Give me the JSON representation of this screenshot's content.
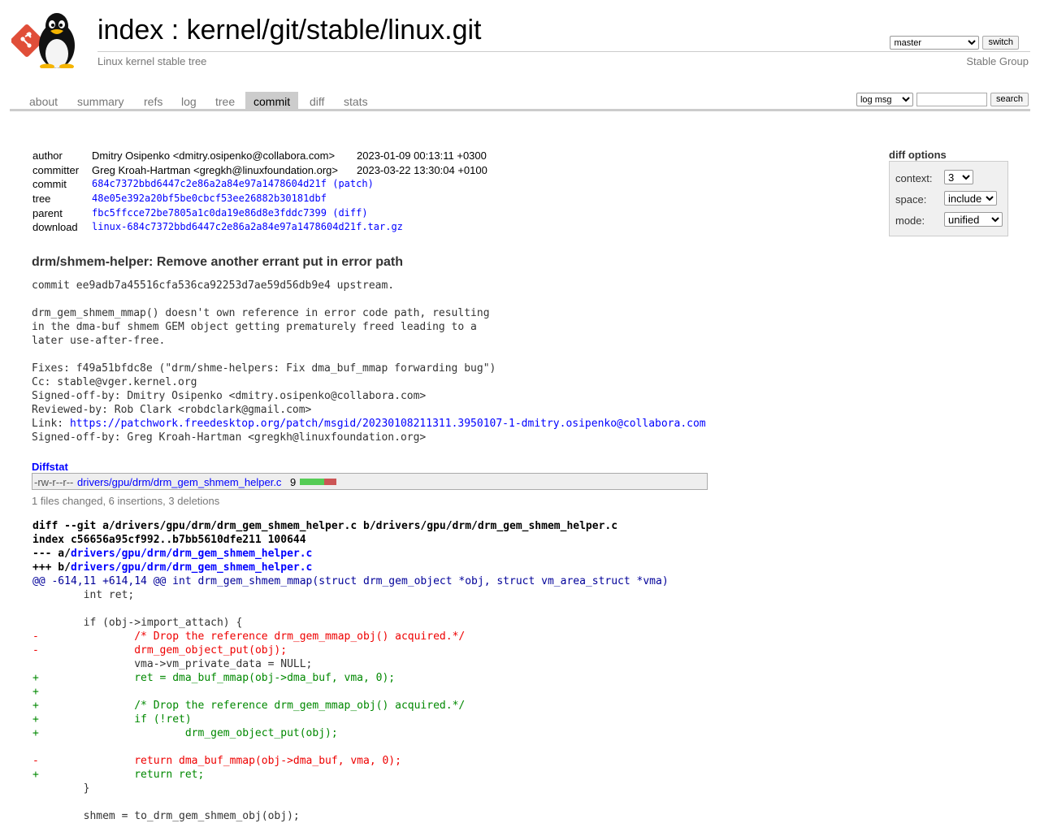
{
  "header": {
    "repo_prefix": "index",
    "separator": " : ",
    "repo_path": "kernel/git/stable/linux.git",
    "description": "Linux kernel stable tree",
    "owner": "Stable Group",
    "branch_selected": "master",
    "switch_label": "switch"
  },
  "tabs": [
    {
      "label": "about",
      "active": false
    },
    {
      "label": "summary",
      "active": false
    },
    {
      "label": "refs",
      "active": false
    },
    {
      "label": "log",
      "active": false
    },
    {
      "label": "tree",
      "active": false
    },
    {
      "label": "commit",
      "active": true
    },
    {
      "label": "diff",
      "active": false
    },
    {
      "label": "stats",
      "active": false
    }
  ],
  "search": {
    "type_selected": "log msg",
    "query": "",
    "button_label": "search"
  },
  "commit_info": {
    "author_label": "author",
    "author": "Dmitry Osipenko <dmitry.osipenko@collabora.com>",
    "author_date": "2023-01-09 00:13:11 +0300",
    "committer_label": "committer",
    "committer": "Greg Kroah-Hartman <gregkh@linuxfoundation.org>",
    "committer_date": "2023-03-22 13:30:04 +0100",
    "commit_label": "commit",
    "commit_hash": "684c7372bbd6447c2e86a2a84e97a1478604d21f",
    "commit_extra": "(patch)",
    "tree_label": "tree",
    "tree_hash": "48e05e392a20bf5be0cbcf53ee26882b30181dbf",
    "parent_label": "parent",
    "parent_hash": "fbc5ffcce72be7805a1c0da19e86d8e3fddc7399",
    "parent_extra": "(diff)",
    "download_label": "download",
    "download_file": "linux-684c7372bbd6447c2e86a2a84e97a1478604d21f.tar.gz"
  },
  "diff_options": {
    "title": "diff options",
    "context_label": "context:",
    "context_value": "3",
    "space_label": "space:",
    "space_value": "include",
    "mode_label": "mode:",
    "mode_value": "unified"
  },
  "commit_subject": "drm/shmem-helper: Remove another errant put in error path",
  "commit_message": {
    "before_link": "commit ee9adb7a45516cfa536ca92253d7ae59d56db9e4 upstream.\n\ndrm_gem_shmem_mmap() doesn't own reference in error code path, resulting\nin the dma-buf shmem GEM object getting prematurely freed leading to a\nlater use-after-free.\n\nFixes: f49a51bfdc8e (\"drm/shme-helpers: Fix dma_buf_mmap forwarding bug\")\nCc: stable@vger.kernel.org\nSigned-off-by: Dmitry Osipenko <dmitry.osipenko@collabora.com>\nReviewed-by: Rob Clark <robdclark@gmail.com>\nLink: ",
    "link": "https://patchwork.freedesktop.org/patch/msgid/20230108211311.3950107-1-dmitry.osipenko@collabora.com",
    "after_link": "\nSigned-off-by: Greg Kroah-Hartman <gregkh@linuxfoundation.org>"
  },
  "diffstat": {
    "header": "Diffstat",
    "mode": "-rw-r--r--",
    "path": "drivers/gpu/drm/drm_gem_shmem_helper.c",
    "count": "9",
    "insertions": 6,
    "deletions": 3,
    "summary": "1 files changed, 6 insertions, 3 deletions",
    "insert_color": "#55cc55",
    "delete_color": "#cc5555"
  },
  "diff": {
    "git_line_prefix": "diff --git a/drivers/gpu/drm/drm_gem_shmem_helper.c b/drivers/gpu/drm/drm_gem_shmem_helper.c",
    "index_line": "index c56656a95cf992..b7bb5610dfe211 100644",
    "minus_prefix": "--- a/",
    "minus_path": "drivers/gpu/drm/drm_gem_shmem_helper.c",
    "plus_prefix": "+++ b/",
    "plus_path": "drivers/gpu/drm/drm_gem_shmem_helper.c",
    "hunk": "@@ -614,11 +614,14 @@ int drm_gem_shmem_mmap(struct drm_gem_object *obj, struct vm_area_struct *vma)",
    "lines": [
      {
        "type": "ctx",
        "text": " \tint ret;"
      },
      {
        "type": "ctx",
        "text": " "
      },
      {
        "type": "ctx",
        "text": " \tif (obj->import_attach) {"
      },
      {
        "type": "del",
        "text": "-\t\t/* Drop the reference drm_gem_mmap_obj() acquired.*/"
      },
      {
        "type": "del",
        "text": "-\t\tdrm_gem_object_put(obj);"
      },
      {
        "type": "ctx",
        "text": " \t\tvma->vm_private_data = NULL;"
      },
      {
        "type": "add",
        "text": "+\t\tret = dma_buf_mmap(obj->dma_buf, vma, 0);"
      },
      {
        "type": "add",
        "text": "+"
      },
      {
        "type": "add",
        "text": "+\t\t/* Drop the reference drm_gem_mmap_obj() acquired.*/"
      },
      {
        "type": "add",
        "text": "+\t\tif (!ret)"
      },
      {
        "type": "add",
        "text": "+\t\t\tdrm_gem_object_put(obj);"
      },
      {
        "type": "ctx",
        "text": " "
      },
      {
        "type": "del",
        "text": "-\t\treturn dma_buf_mmap(obj->dma_buf, vma, 0);"
      },
      {
        "type": "add",
        "text": "+\t\treturn ret;"
      },
      {
        "type": "ctx",
        "text": " \t}"
      },
      {
        "type": "ctx",
        "text": " "
      },
      {
        "type": "ctx",
        "text": " \tshmem = to_drm_gem_shmem_obj(obj);"
      }
    ]
  },
  "icons": {
    "logo": "tux-git-logo-icon"
  }
}
